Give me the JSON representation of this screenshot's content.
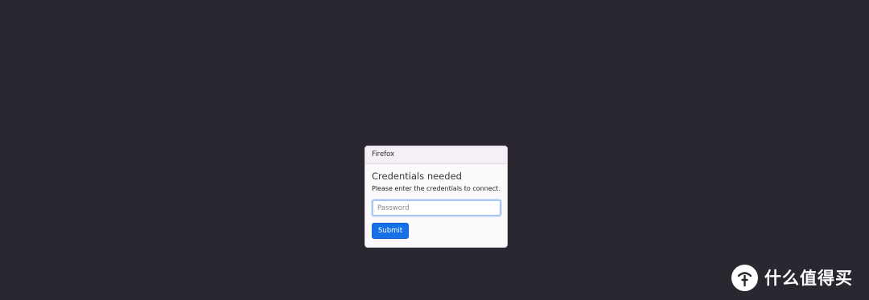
{
  "dialog": {
    "header_title": "Firefox",
    "title": "Credentials needed",
    "message": "Please enter the credentials to connect.",
    "password": {
      "value": "",
      "placeholder": "Password"
    },
    "submit_label": "Submit"
  },
  "watermark": {
    "icon": "smzdm-logo-icon",
    "text": "什么值得买"
  },
  "colors": {
    "background": "#2b2730",
    "dialog_header": "#f6eff8",
    "primary_button": "#1670e8"
  }
}
